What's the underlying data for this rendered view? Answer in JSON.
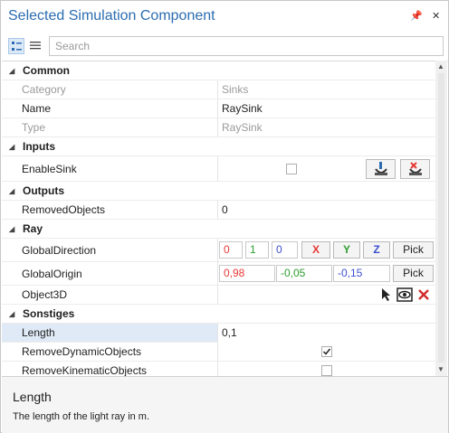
{
  "window": {
    "title": "Selected Simulation Component",
    "pin_glyph": "📌",
    "close_glyph": "✕"
  },
  "toolbar": {
    "search_placeholder": "Search"
  },
  "groups": {
    "common": "Common",
    "inputs": "Inputs",
    "outputs": "Outputs",
    "ray": "Ray",
    "sonstiges": "Sonstiges"
  },
  "props": {
    "category": {
      "name": "Category",
      "value": "Sinks"
    },
    "name": {
      "name": "Name",
      "value": "RaySink"
    },
    "type": {
      "name": "Type",
      "value": "RaySink"
    },
    "enable_sink": {
      "name": "EnableSink"
    },
    "removed_objects": {
      "name": "RemovedObjects",
      "value": "0"
    },
    "global_direction": {
      "name": "GlobalDirection",
      "x": "0",
      "y": "1",
      "z": "0"
    },
    "global_origin": {
      "name": "GlobalOrigin",
      "x": "0,98",
      "y": "-0,05",
      "z": "-0,15"
    },
    "object3d": {
      "name": "Object3D"
    },
    "length": {
      "name": "Length",
      "value": "0,1"
    },
    "remove_dynamic": {
      "name": "RemoveDynamicObjects",
      "checked": true
    },
    "remove_kinematic": {
      "name": "RemoveKinematicObjects",
      "checked": false
    }
  },
  "buttons": {
    "x": "X",
    "y": "Y",
    "z": "Z",
    "pick": "Pick"
  },
  "colors": {
    "x": "#e53935",
    "y": "#2e9e2e",
    "z": "#3b4fcf",
    "accent": "#2b6cb0"
  },
  "description": {
    "title": "Length",
    "text": "The length of the light ray in m."
  }
}
